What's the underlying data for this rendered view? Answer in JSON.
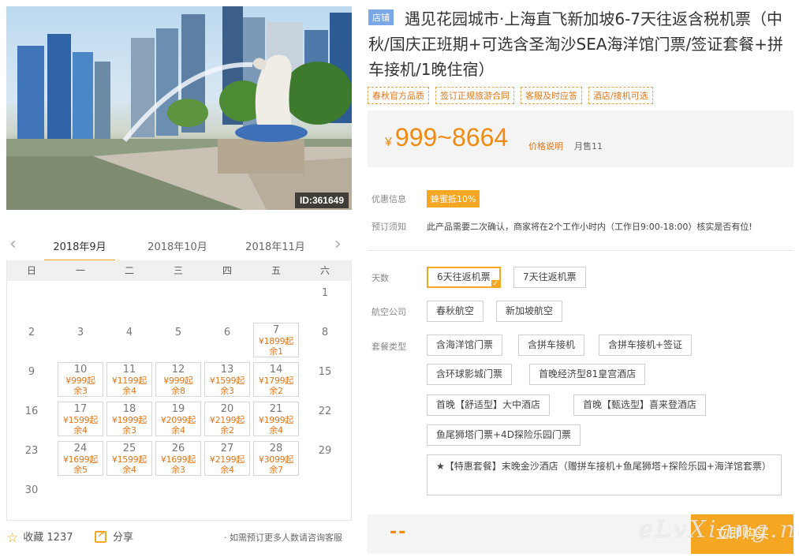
{
  "hero": {
    "id_badge": "ID:361649"
  },
  "calendar": {
    "prev_icon": "chevron-left-icon",
    "next_icon": "chevron-right-icon",
    "months": [
      "2018年9月",
      "2018年10月",
      "2018年11月"
    ],
    "active_month": 0,
    "weekdays": [
      "日",
      "一",
      "二",
      "三",
      "四",
      "五",
      "六"
    ],
    "leading_blanks": 6,
    "days": [
      {
        "d": "1"
      },
      {
        "d": "2"
      },
      {
        "d": "3"
      },
      {
        "d": "4"
      },
      {
        "d": "5"
      },
      {
        "d": "6"
      },
      {
        "d": "7",
        "price": "¥1899起",
        "rem": "余1"
      },
      {
        "d": "8"
      },
      {
        "d": "9"
      },
      {
        "d": "10",
        "price": "¥999起",
        "rem": "余3"
      },
      {
        "d": "11",
        "price": "¥1199起",
        "rem": "余4"
      },
      {
        "d": "12",
        "price": "¥999起",
        "rem": "余8"
      },
      {
        "d": "13",
        "price": "¥1599起",
        "rem": "余3"
      },
      {
        "d": "14",
        "price": "¥1799起",
        "rem": "余2"
      },
      {
        "d": "15"
      },
      {
        "d": "16"
      },
      {
        "d": "17",
        "price": "¥1599起",
        "rem": "余4"
      },
      {
        "d": "18",
        "price": "¥1999起",
        "rem": "余3"
      },
      {
        "d": "19",
        "price": "¥2099起",
        "rem": "余4"
      },
      {
        "d": "20",
        "price": "¥2199起",
        "rem": "余2"
      },
      {
        "d": "21",
        "price": "¥1999起",
        "rem": "余4"
      },
      {
        "d": "22"
      },
      {
        "d": "23"
      },
      {
        "d": "24",
        "price": "¥1699起",
        "rem": "余5"
      },
      {
        "d": "25",
        "price": "¥1599起",
        "rem": "余4"
      },
      {
        "d": "26",
        "price": "¥1699起",
        "rem": "余3"
      },
      {
        "d": "27",
        "price": "¥2199起",
        "rem": "余4"
      },
      {
        "d": "28",
        "price": "¥3099起",
        "rem": "余7"
      },
      {
        "d": "29"
      },
      {
        "d": "30"
      }
    ]
  },
  "footer_left": {
    "fav_label": "收藏",
    "fav_count": "1237",
    "share_label": "分享",
    "consult": "· 如需预订更多人数请咨询客服"
  },
  "product": {
    "store_badge": "店铺",
    "title": "遇见花园城市·上海直飞新加坡6-7天往返含税机票（中秋/国庆正班期+可选含圣淘沙SEA海洋馆门票/签证套餐+拼车接机/1晚住宿）",
    "tags": [
      "春秋官方品质",
      "签订正规旅游合同",
      "客服及时应答",
      "酒店/接机可选"
    ],
    "price_yen": "¥",
    "price_range": "999~8664",
    "price_note": "价格说明",
    "monthly_sales": "月售11",
    "discount_label": "优惠信息",
    "discount_badge": "蜂蜜抵10%",
    "notice_label": "预订须知",
    "notice_text": "此产品需要二次确认，商家将在2个工作小时内（工作日9:00-18:00）核实是否有位!"
  },
  "options": {
    "days_label": "天数",
    "days": [
      "6天往返机票",
      "7天往返机票"
    ],
    "airline_label": "航空公司",
    "airlines": [
      "春秋航空",
      "新加坡航空"
    ],
    "package_label": "套餐类型",
    "packages": [
      "含海洋馆门票",
      "含拼车接机",
      "含拼车接机+签证",
      "含环球影城门票",
      "首晚经济型81皇宫酒店",
      "首晚【舒适型】大中酒店",
      "首晚【甄选型】喜来登酒店",
      "鱼尾狮塔门票+4D探险乐园门票",
      "★【特惠套餐】末晚金沙酒店（赠拼车接机+鱼尾狮塔+探险乐园+海洋馆套票）"
    ]
  },
  "buy_bar": {
    "price": "--",
    "buy_label": "立即购买",
    "watermark": "eLvXiang.net"
  },
  "colors": {
    "accent": "#f5a623",
    "price": "#f08a13",
    "badge_blue": "#7aa8e6"
  }
}
